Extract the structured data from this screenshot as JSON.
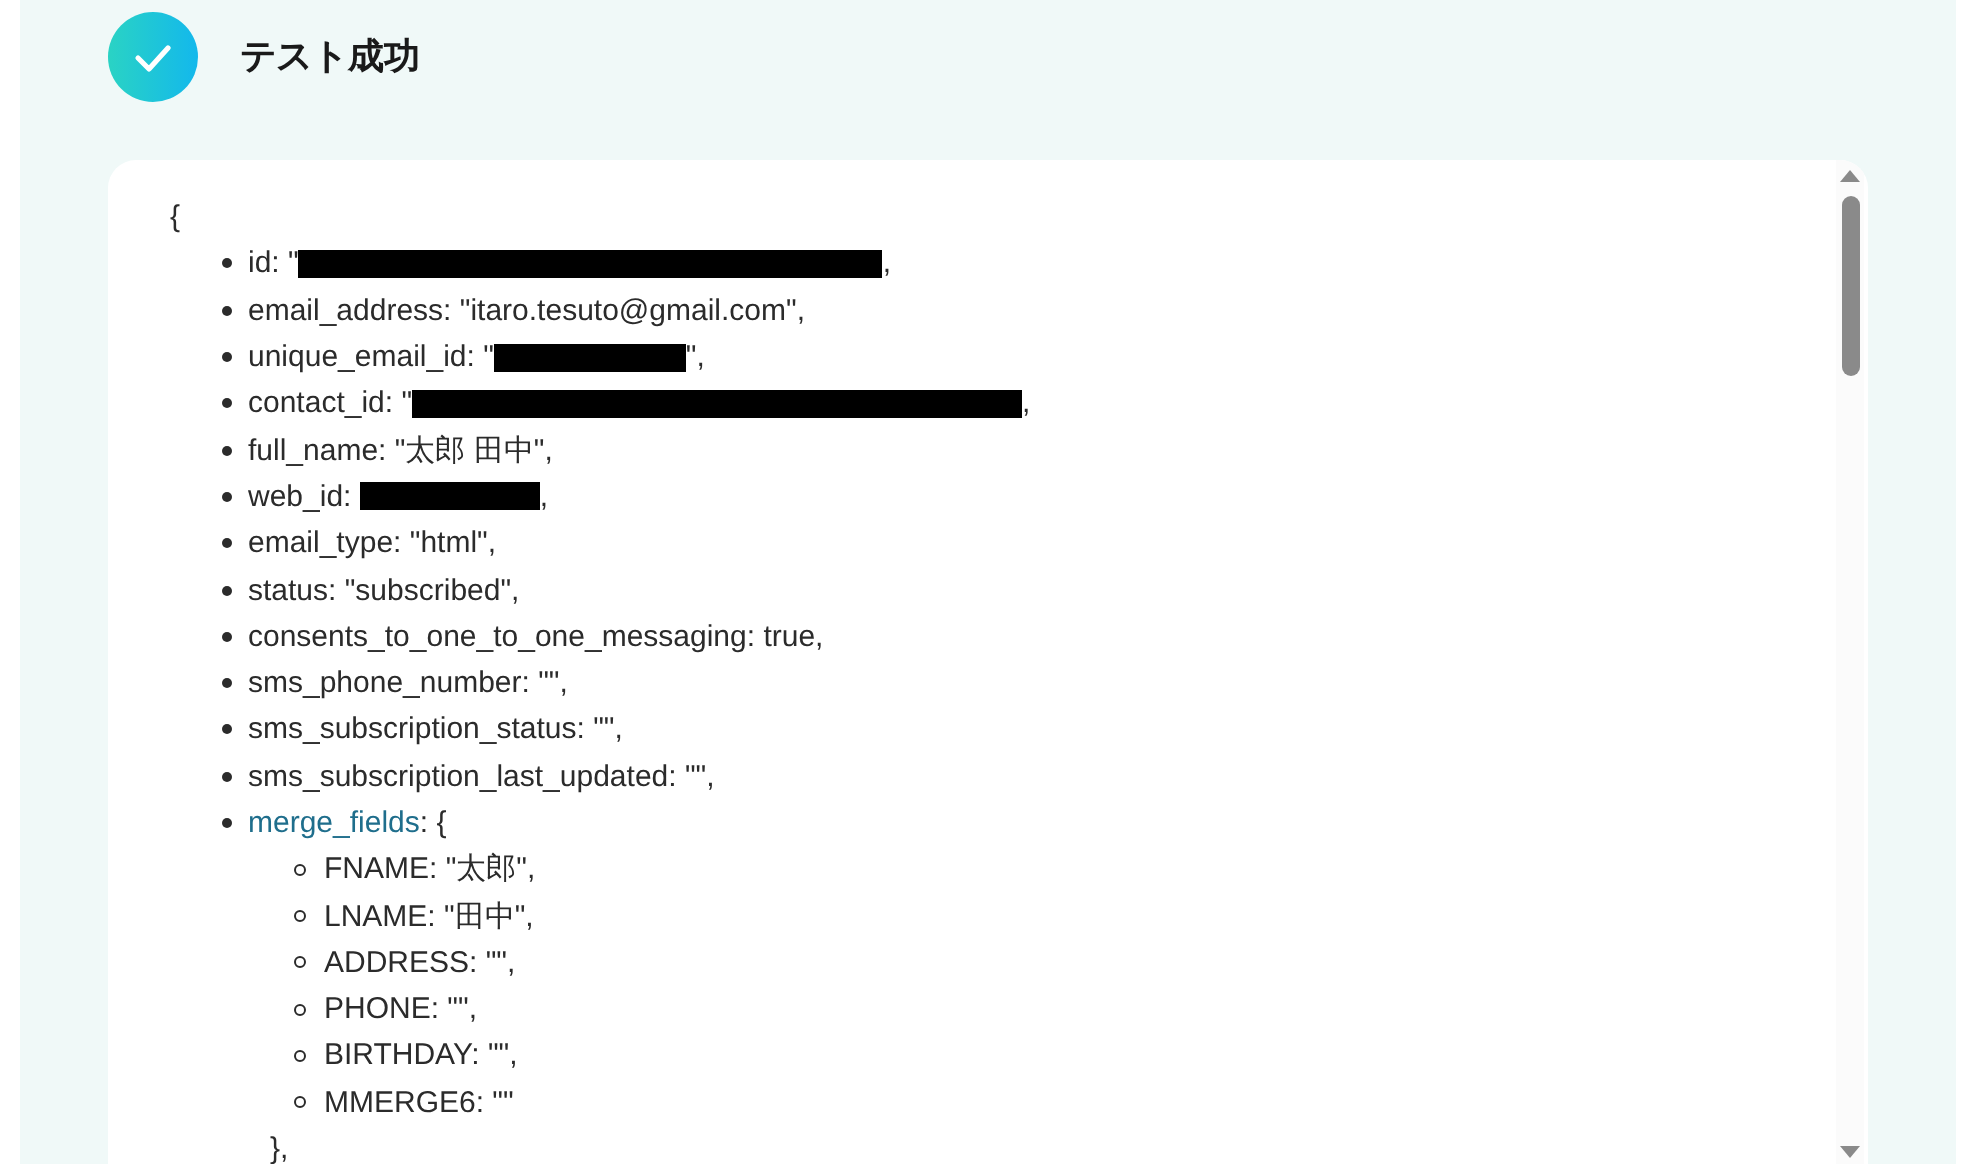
{
  "header": {
    "title": "テスト成功"
  },
  "json_view": {
    "open_brace": "{",
    "items": [
      {
        "kind": "field",
        "parts": [
          {
            "kind": "text",
            "text": "id: \""
          },
          {
            "kind": "redaction"
          },
          {
            "kind": "text",
            "text": ","
          }
        ]
      },
      {
        "kind": "field",
        "parts": [
          {
            "kind": "text",
            "text": "email_address: \"itaro.tesuto@gmail.com\","
          }
        ]
      },
      {
        "kind": "field",
        "parts": [
          {
            "kind": "text",
            "text": "unique_email_id: \""
          },
          {
            "kind": "redaction"
          },
          {
            "kind": "text",
            "text": "\","
          }
        ]
      },
      {
        "kind": "field",
        "parts": [
          {
            "kind": "text",
            "text": "contact_id: \""
          },
          {
            "kind": "redaction"
          },
          {
            "kind": "text",
            "text": ","
          }
        ]
      },
      {
        "kind": "field",
        "parts": [
          {
            "kind": "text",
            "text": "full_name: \"太郎 田中\","
          }
        ]
      },
      {
        "kind": "field",
        "parts": [
          {
            "kind": "text",
            "text": "web_id: "
          },
          {
            "kind": "redaction"
          },
          {
            "kind": "text",
            "text": ","
          }
        ]
      },
      {
        "kind": "field",
        "parts": [
          {
            "kind": "text",
            "text": "email_type: \"html\","
          }
        ]
      },
      {
        "kind": "field",
        "parts": [
          {
            "kind": "text",
            "text": "status: \"subscribed\","
          }
        ]
      },
      {
        "kind": "field",
        "parts": [
          {
            "kind": "text",
            "text": "consents_to_one_to_one_messaging: true,"
          }
        ]
      },
      {
        "kind": "field",
        "parts": [
          {
            "kind": "text",
            "text": "sms_phone_number: \"\","
          }
        ]
      },
      {
        "kind": "field",
        "parts": [
          {
            "kind": "text",
            "text": "sms_subscription_status: \"\","
          }
        ]
      },
      {
        "kind": "field",
        "parts": [
          {
            "kind": "text",
            "text": "sms_subscription_last_updated: \"\","
          }
        ]
      },
      {
        "kind": "object",
        "key": "merge_fields",
        "open": ": {",
        "close": "},",
        "children": [
          {
            "kind": "field",
            "parts": [
              {
                "kind": "text",
                "text": "FNAME: \"太郎\","
              }
            ]
          },
          {
            "kind": "field",
            "parts": [
              {
                "kind": "text",
                "text": "LNAME: \"田中\","
              }
            ]
          },
          {
            "kind": "field",
            "parts": [
              {
                "kind": "text",
                "text": "ADDRESS: \"\","
              }
            ]
          },
          {
            "kind": "field",
            "parts": [
              {
                "kind": "text",
                "text": "PHONE: \"\","
              }
            ]
          },
          {
            "kind": "field",
            "parts": [
              {
                "kind": "text",
                "text": "BIRTHDAY: \"\","
              }
            ]
          },
          {
            "kind": "field",
            "parts": [
              {
                "kind": "text",
                "text": "MMERGE6: \"\""
              }
            ]
          }
        ]
      }
    ]
  }
}
